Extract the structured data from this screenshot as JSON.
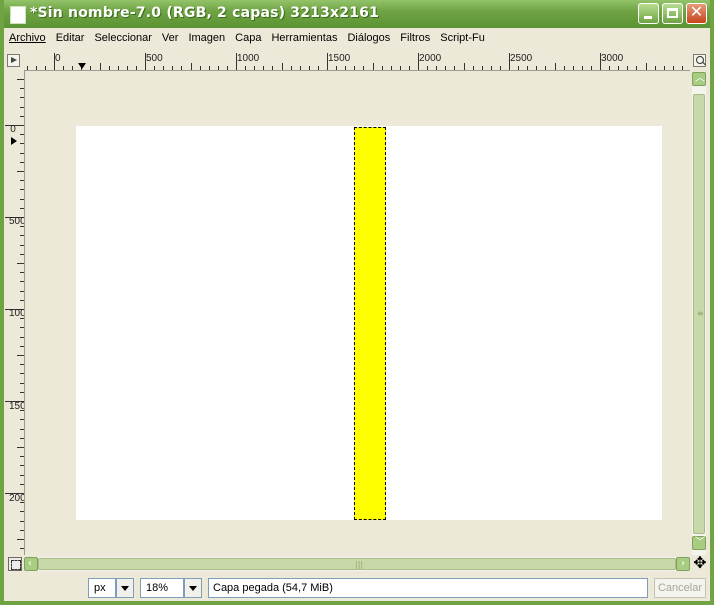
{
  "window": {
    "title": "*Sin nombre-7.0 (RGB, 2 capas) 3213x2161"
  },
  "menu": [
    {
      "label": "Archivo"
    },
    {
      "label": "Editar"
    },
    {
      "label": "Seleccionar"
    },
    {
      "label": "Ver"
    },
    {
      "label": "Imagen"
    },
    {
      "label": "Capa"
    },
    {
      "label": "Herramientas"
    },
    {
      "label": "Diálogos"
    },
    {
      "label": "Filtros"
    },
    {
      "label": "Script-Fu"
    }
  ],
  "ruler": {
    "horizontal_labels": [
      "0",
      "500",
      "1000",
      "1500",
      "2000",
      "2500",
      "3000"
    ],
    "vertical_labels": [
      "0",
      "500",
      "1000",
      "1500",
      "2000"
    ]
  },
  "colors": {
    "titlebar": "#6fa343",
    "canvas_background": "#ffffff",
    "layer_fill": "#ffff00"
  },
  "status": {
    "unit": "px",
    "zoom": "18%",
    "message": "Capa pegada (54,7 MiB)",
    "cancel_label": "Cancelar"
  },
  "icons": {
    "app": "gimp-window-icon",
    "minimize": "minimize-icon",
    "maximize": "maximize-icon",
    "close": "close-icon",
    "zoom": "magnifier-icon",
    "navigate": "navigate-icon",
    "move": "move-cross-icon"
  }
}
